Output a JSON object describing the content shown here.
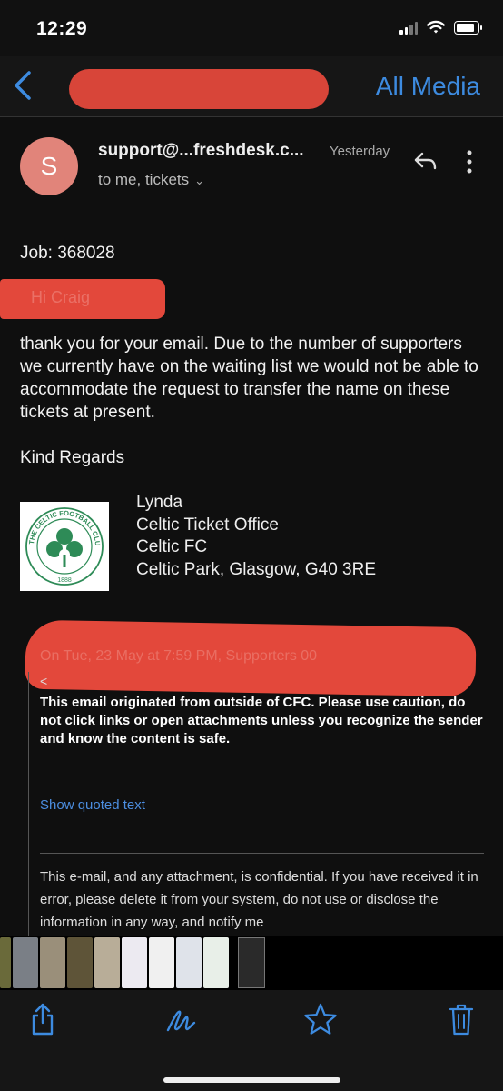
{
  "status": {
    "time": "12:29"
  },
  "nav": {
    "back_label": "",
    "all_media": "All Media"
  },
  "email": {
    "avatar_letter": "S",
    "sender": "support@...freshdesk.c...",
    "when": "Yesterday",
    "recipients": "to me, tickets",
    "job": "Job: 368028",
    "greeting": "Hi Craig",
    "paragraph": "thank you for your email. Due to the number of supporters we currently have on the waiting list we would not be able to accommodate the request to transfer the name on these tickets at present.",
    "regards": "Kind Regards",
    "signature": {
      "name": "Lynda",
      "office": "Celtic Ticket Office",
      "club": "Celtic FC",
      "address": "Celtic Park, Glasgow, G40 3RE"
    },
    "logo_text_top": "THE CELTIC FOOTBALL CLUB",
    "logo_year": "1888",
    "quote_header": "On Tue, 23 May at 7:59 PM, Supporters 00",
    "quote_lt": "<",
    "warning": "This email originated from outside of CFC. Please use caution, do not click links or open attachments unless you recognize the sender and know the content is safe.",
    "show_quoted": "Show quoted text",
    "confidential": "This e-mail, and any attachment, is confidential. If you have received it in error, please delete it from your system, do not use or disclose the information in any way, and notify me"
  },
  "colors": {
    "accent": "#3d8be0",
    "redaction": "#e3483b",
    "avatar": "#e1847a"
  },
  "icons": {
    "toolbar": [
      "share-icon",
      "markup-icon",
      "favorite-star-icon",
      "trash-icon"
    ]
  }
}
